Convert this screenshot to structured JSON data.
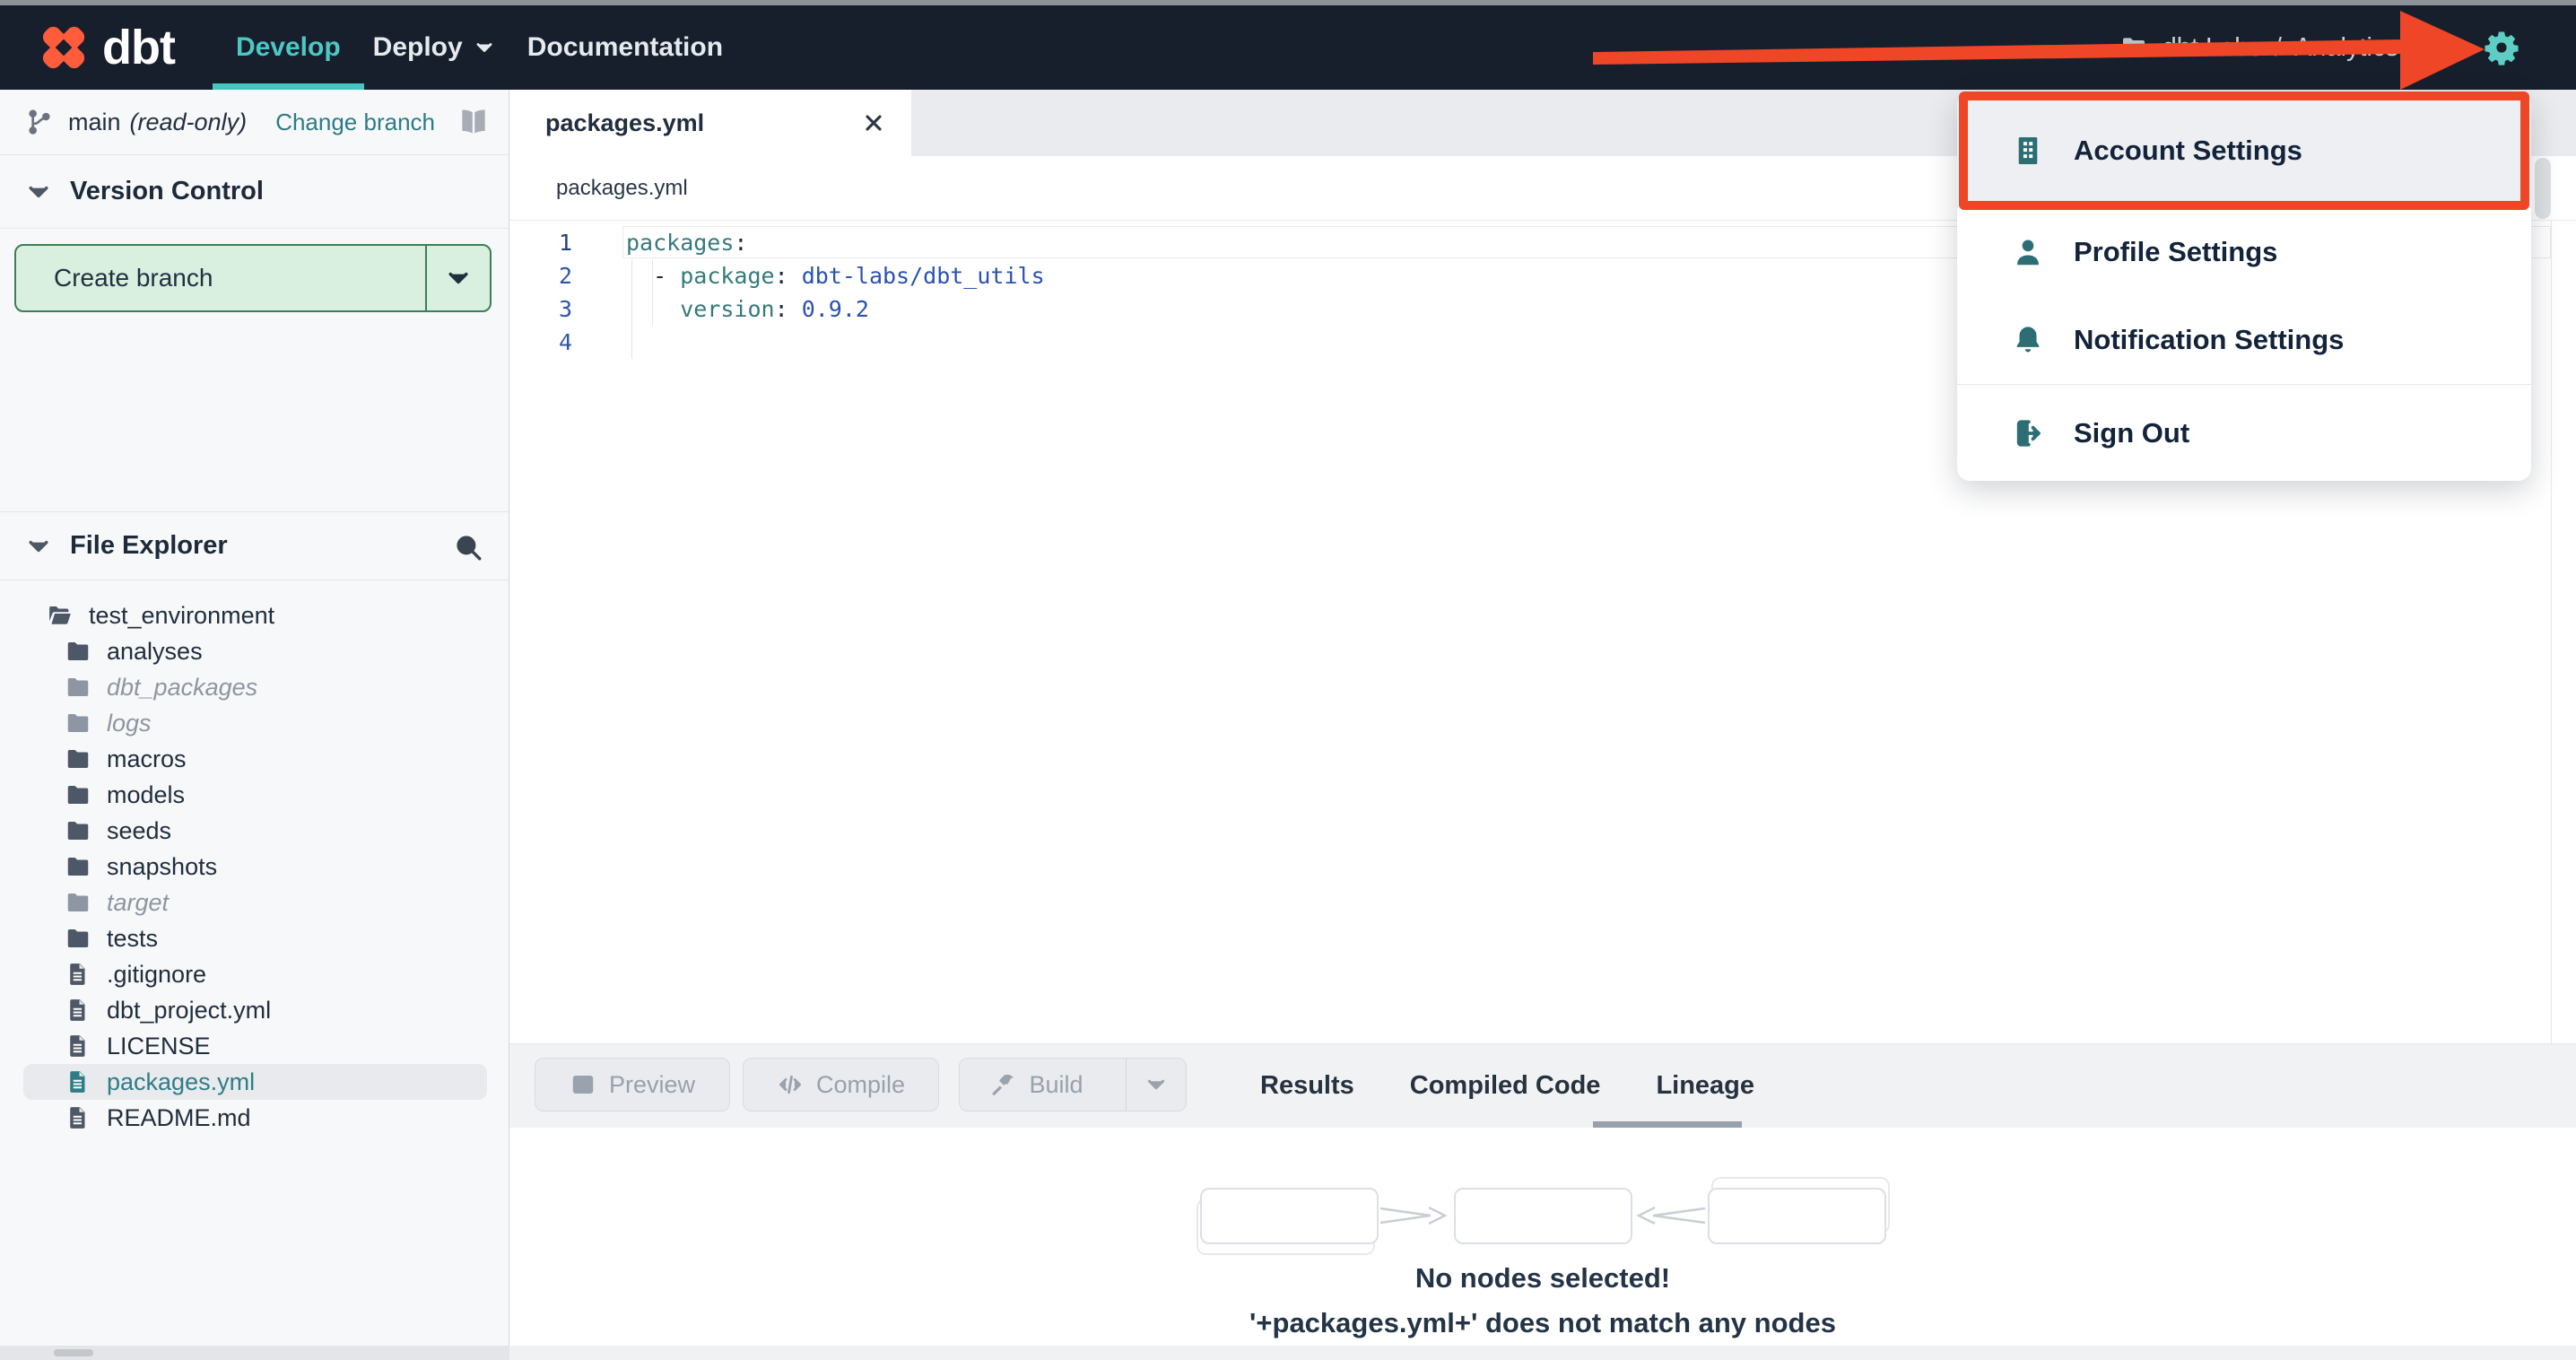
{
  "navbar": {
    "logo_text": "dbt",
    "items": [
      {
        "label": "Develop",
        "active": true
      },
      {
        "label": "Deploy",
        "caret": true
      },
      {
        "label": "Documentation"
      }
    ],
    "account": {
      "org": "dbt Labs",
      "separator": "/",
      "project": "Analytics"
    },
    "icons": [
      "dbt-logo-icon",
      "folder-icon",
      "question-circle-icon",
      "gear-icon"
    ]
  },
  "user_menu": {
    "items": [
      {
        "icon": "building-icon",
        "label": "Account Settings",
        "highlighted": true
      },
      {
        "icon": "user-icon",
        "label": "Profile Settings"
      },
      {
        "icon": "bell-icon",
        "label": "Notification Settings"
      },
      {
        "icon": "sign-out-icon",
        "label": "Sign Out",
        "divider_above": true
      }
    ]
  },
  "annotation": {
    "arrow_color": "#ee4626",
    "box_color": "#ee4626",
    "highlighted_item": "Account Settings"
  },
  "version_control": {
    "branch": "main",
    "branch_mode": "(read-only)",
    "change_branch": "Change branch",
    "section_title": "Version Control",
    "create_branch": "Create branch"
  },
  "file_explorer": {
    "section_title": "File Explorer",
    "tree": [
      {
        "name": "test_environment",
        "icon": "folder-open-icon",
        "depth": 0
      },
      {
        "name": "analyses",
        "icon": "folder-icon",
        "depth": 1
      },
      {
        "name": "dbt_packages",
        "icon": "folder-icon",
        "depth": 1,
        "italic": true
      },
      {
        "name": "logs",
        "icon": "folder-icon",
        "depth": 1,
        "italic": true
      },
      {
        "name": "macros",
        "icon": "folder-icon",
        "depth": 1
      },
      {
        "name": "models",
        "icon": "folder-icon",
        "depth": 1
      },
      {
        "name": "seeds",
        "icon": "folder-icon",
        "depth": 1
      },
      {
        "name": "snapshots",
        "icon": "folder-icon",
        "depth": 1
      },
      {
        "name": "target",
        "icon": "folder-icon",
        "depth": 1,
        "italic": true
      },
      {
        "name": "tests",
        "icon": "folder-icon",
        "depth": 1
      },
      {
        "name": ".gitignore",
        "icon": "file-icon",
        "depth": 1
      },
      {
        "name": "dbt_project.yml",
        "icon": "file-icon",
        "depth": 1
      },
      {
        "name": "LICENSE",
        "icon": "file-icon",
        "depth": 1
      },
      {
        "name": "packages.yml",
        "icon": "file-icon",
        "depth": 1,
        "selected": true
      },
      {
        "name": "README.md",
        "icon": "file-icon",
        "depth": 1
      }
    ]
  },
  "editor": {
    "tab_label": "packages.yml",
    "breadcrumb": "packages.yml",
    "lines": [
      {
        "num": "1",
        "active": true,
        "tokens": [
          {
            "c": "key",
            "t": "packages"
          },
          {
            "c": "punc",
            "t": ":"
          }
        ]
      },
      {
        "num": "2",
        "tokens": [
          {
            "c": "plain",
            "t": "  - "
          },
          {
            "c": "key",
            "t": "package"
          },
          {
            "c": "punc",
            "t": ":"
          },
          {
            "c": "val",
            "t": " dbt-labs/dbt_utils"
          }
        ]
      },
      {
        "num": "3",
        "tokens": [
          {
            "c": "plain",
            "t": "    "
          },
          {
            "c": "key",
            "t": "version"
          },
          {
            "c": "punc",
            "t": ":"
          },
          {
            "c": "val",
            "t": " 0.9.2"
          }
        ]
      },
      {
        "num": "4",
        "tokens": []
      }
    ]
  },
  "bottom_bar": {
    "buttons": [
      {
        "label": "Preview",
        "icon": "table-icon",
        "disabled": true
      },
      {
        "label": "Compile",
        "icon": "code-icon",
        "disabled": true
      },
      {
        "label": "Build",
        "icon": "hammer-icon",
        "disabled": true,
        "split": true
      }
    ],
    "tabs": [
      {
        "label": "Results"
      },
      {
        "label": "Compiled Code"
      },
      {
        "label": "Lineage",
        "active": true
      }
    ]
  },
  "lineage": {
    "empty_title": "No nodes selected!",
    "empty_message": "'+packages.yml+' does not match any nodes"
  },
  "colors": {
    "navbar_bg": "#171f2d",
    "accent_teal": "#4cc8c3",
    "gear_teal": "#5ecec4",
    "brand_orange": "#ff5c3c",
    "annotation_red": "#ee4626",
    "menu_icon_teal": "#2d6e74",
    "link_teal": "#2d7c85",
    "selected_file_teal": "#2e7d86",
    "code_key": "#35797c",
    "code_value": "#2a52ae",
    "create_branch_bg": "#d9f0e1",
    "create_branch_border": "#3f7e57"
  }
}
